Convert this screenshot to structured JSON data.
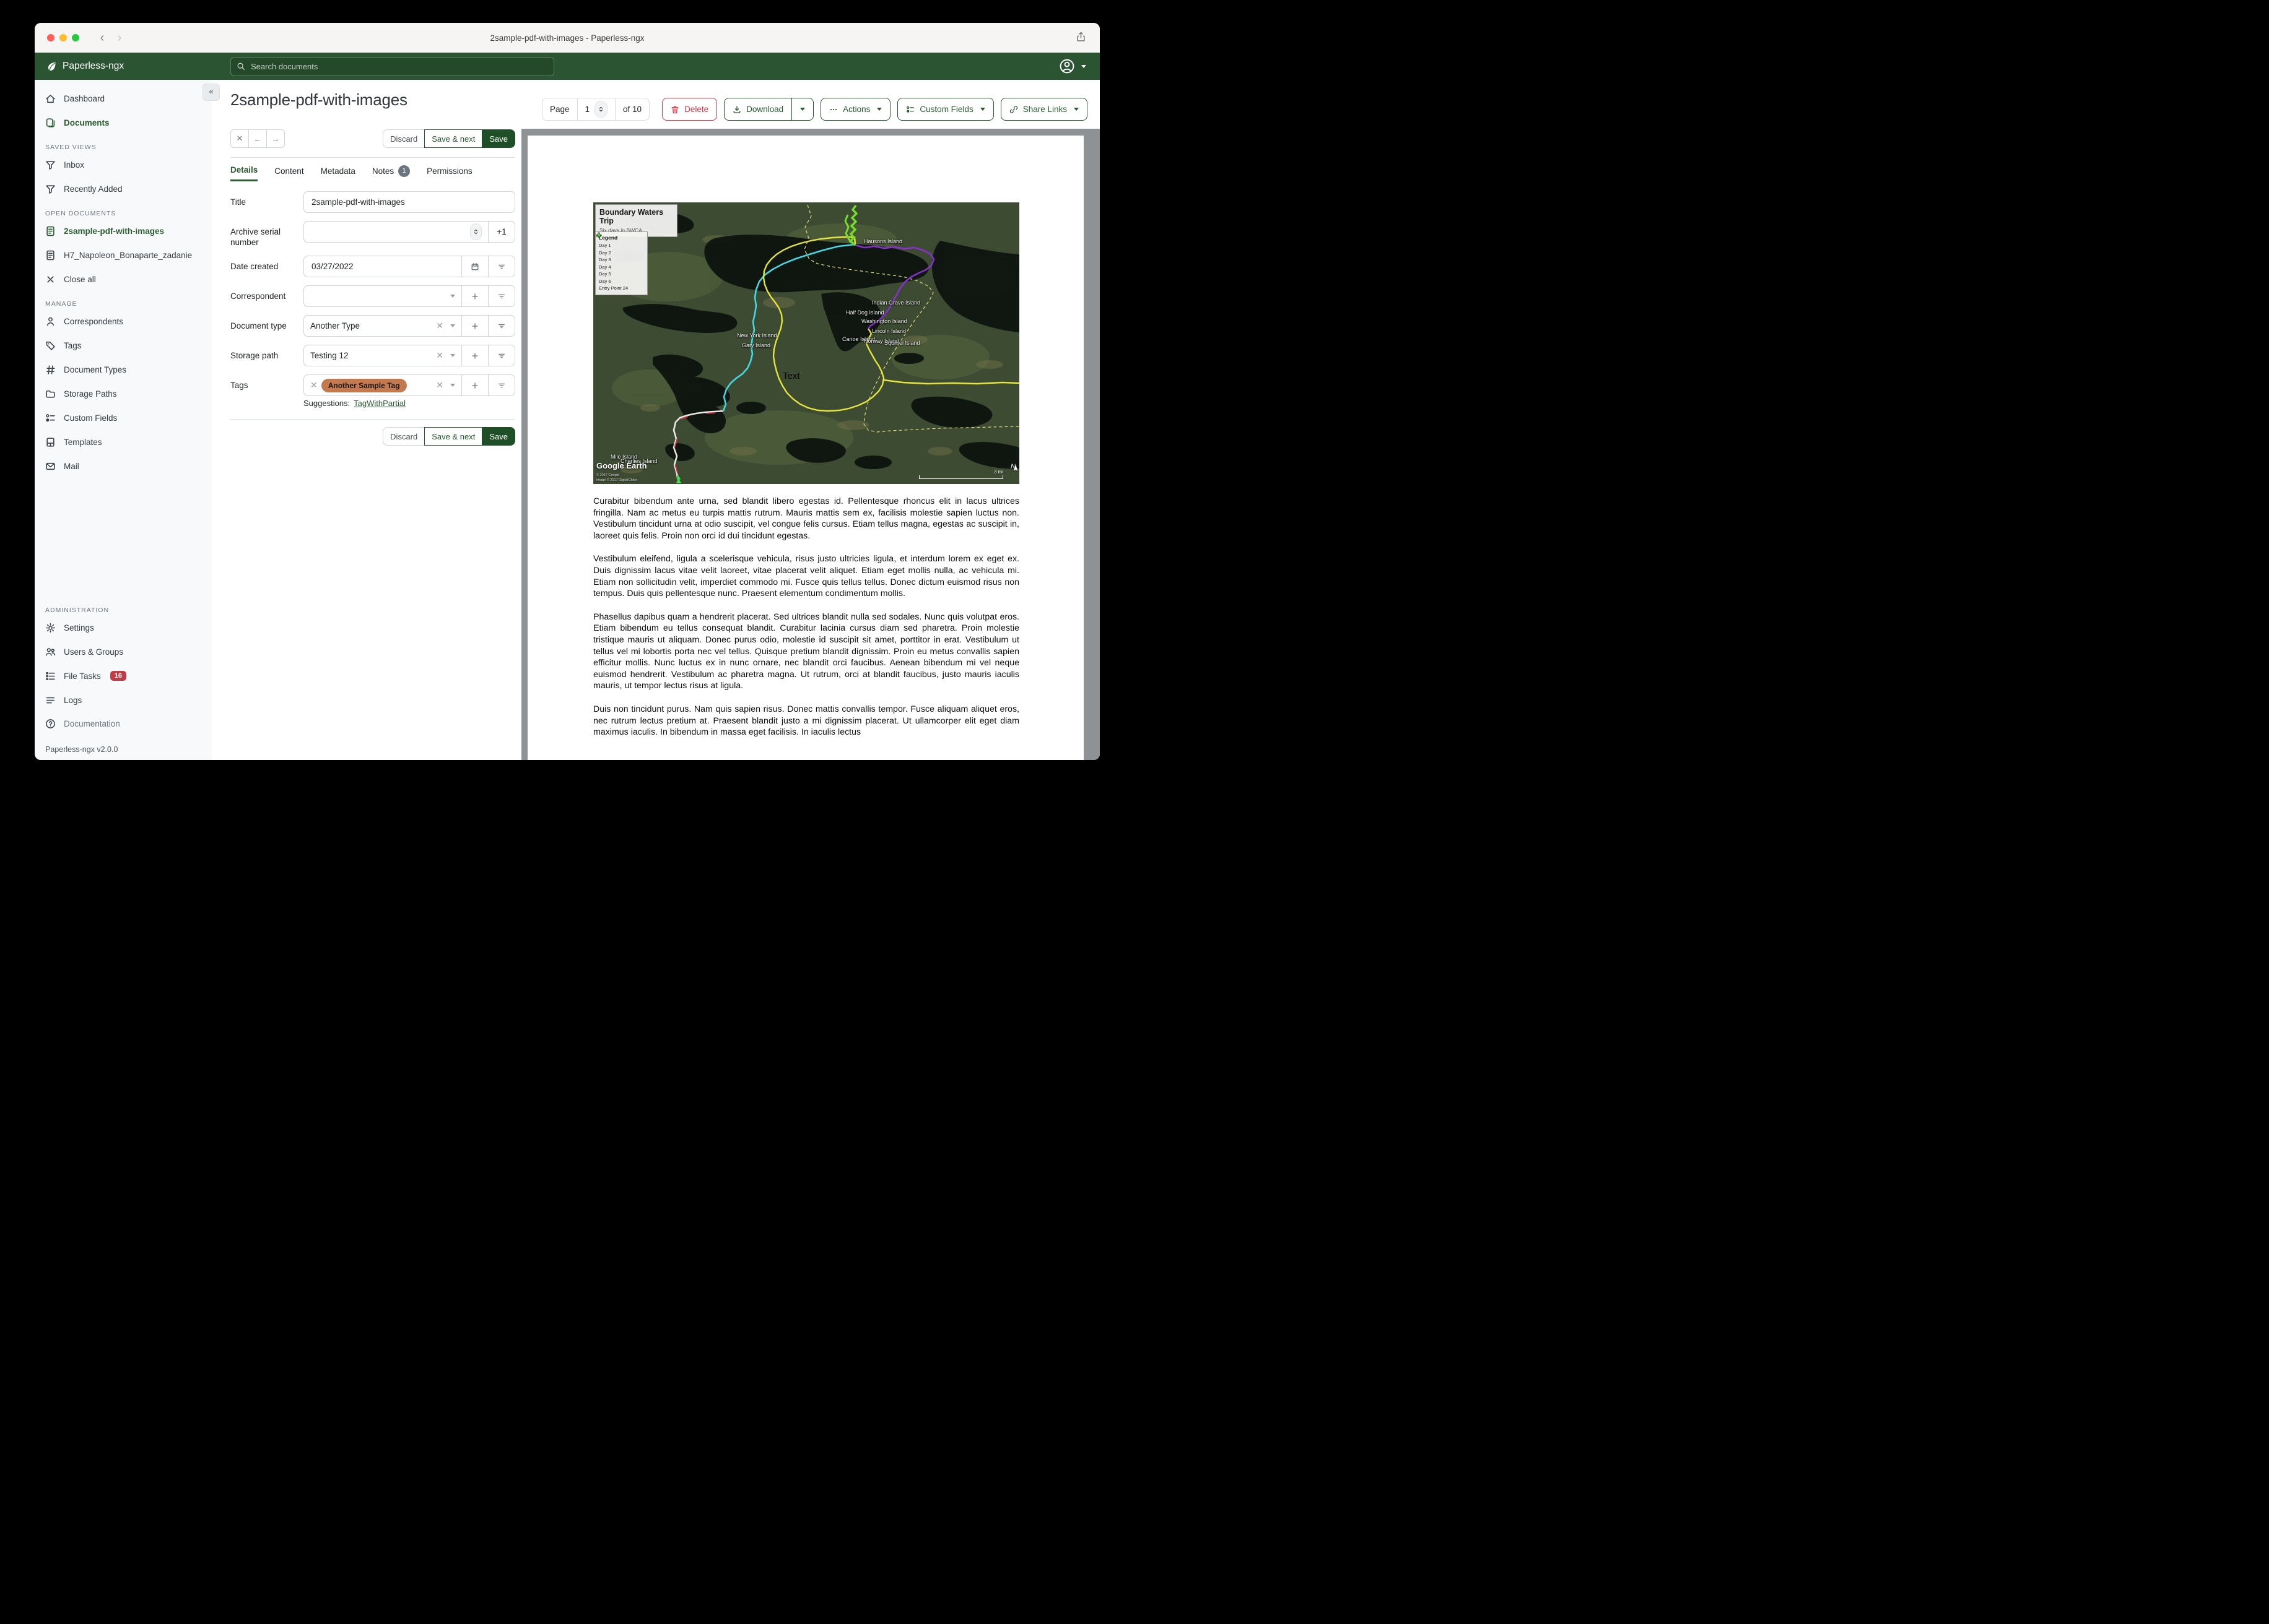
{
  "window": {
    "title": "2sample-pdf-with-images - Paperless-ngx"
  },
  "appbar": {
    "brand": "Paperless-ngx",
    "search_placeholder": "Search documents"
  },
  "colors": {
    "header_green": "#2b5532",
    "accent_green": "#265a2c",
    "save_fill": "#1e4f26",
    "delete_red": "#dc3545",
    "tag_chip": "#c4794e",
    "file_tasks_badge": "#c03c46"
  },
  "sidebar": {
    "primary": [
      {
        "label": "Dashboard"
      },
      {
        "label": "Documents"
      }
    ],
    "sections": [
      {
        "header": "SAVED VIEWS",
        "items": [
          "Inbox",
          "Recently Added"
        ]
      },
      {
        "header": "OPEN DOCUMENTS",
        "items": [
          "2sample-pdf-with-images",
          "H7_Napoleon_Bonaparte_zadanie",
          "Close all"
        ]
      },
      {
        "header": "MANAGE",
        "items": [
          "Correspondents",
          "Tags",
          "Document Types",
          "Storage Paths",
          "Custom Fields",
          "Templates",
          "Mail"
        ]
      },
      {
        "header": "ADMINISTRATION",
        "items": [
          "Settings",
          "Users & Groups",
          "File Tasks",
          "Logs"
        ]
      }
    ],
    "file_tasks_badge": "16",
    "documentation": "Documentation",
    "version": "Paperless-ngx v2.0.0"
  },
  "toolbar": {
    "page_label": "Page",
    "page_value": "1",
    "page_total": "of 10",
    "delete": "Delete",
    "download": "Download",
    "actions": "Actions",
    "custom_fields": "Custom Fields",
    "share_links": "Share Links"
  },
  "editor": {
    "title": "2sample-pdf-with-images",
    "discard": "Discard",
    "save_next": "Save & next",
    "save": "Save",
    "tabs": [
      "Details",
      "Content",
      "Metadata",
      "Notes",
      "Permissions"
    ],
    "notes_badge": "1",
    "fields": {
      "title_label": "Title",
      "title_value": "2sample-pdf-with-images",
      "asn_label": "Archive serial number",
      "asn_plus": "+1",
      "date_label": "Date created",
      "date_value": "03/27/2022",
      "correspondent_label": "Correspondent",
      "doctype_label": "Document type",
      "doctype_value": "Another Type",
      "storage_label": "Storage path",
      "storage_value": "Testing 12",
      "tags_label": "Tags",
      "tag_chip": "Another Sample Tag",
      "suggestions_label": "Suggestions:",
      "suggestion_link": "TagWithPartial"
    }
  },
  "preview": {
    "map": {
      "title": "Boundary Waters Trip",
      "subtitle": "Six days in BWCA",
      "legend_title": "Legend",
      "legend": [
        {
          "label": "Day 1",
          "color": "#e9e9e9"
        },
        {
          "label": "Day 2",
          "color": "#e4e43c"
        },
        {
          "label": "Day 3",
          "color": "#8a2fd0"
        },
        {
          "label": "Day 4",
          "color": "#74dd2c"
        },
        {
          "label": "Day 5",
          "color": "#46d7e4"
        },
        {
          "label": "Day 6",
          "color": "#bf3640"
        },
        {
          "label": "Entry Point 24",
          "color": "#4fe04f"
        }
      ],
      "islands": [
        "Hausons Island",
        "New York Island",
        "Gary Island",
        "Indian Grave Island",
        "Half Dog Island",
        "Washington Island",
        "Lincoln Island",
        "Canoe Island",
        "Norway Island",
        "Squirrel Island",
        "Mile Island",
        "Charlies Island"
      ],
      "text_label": "Text",
      "logo": "Google Earth",
      "copyright1": "© 2017 Google",
      "copyright2": "Image © 2017 DigitalGlobe",
      "scale": "3 mi",
      "compass": "N"
    },
    "paragraphs": [
      "Curabitur bibendum ante urna, sed blandit libero egestas id. Pellentesque rhoncus elit in lacus ultrices fringilla. Nam ac metus eu turpis mattis rutrum. Mauris mattis sem ex, facilisis molestie sapien luctus non. Vestibulum tincidunt urna at odio suscipit, vel congue felis cursus. Etiam tellus magna, egestas ac suscipit in, laoreet quis felis. Proin non orci id dui tincidunt egestas.",
      "Vestibulum eleifend, ligula a scelerisque vehicula, risus justo ultricies ligula, et interdum lorem ex eget ex. Duis dignissim lacus vitae velit laoreet, vitae placerat velit aliquet. Etiam eget mollis nulla, ac vehicula mi. Etiam non sollicitudin velit, imperdiet commodo mi. Fusce quis tellus tellus. Donec dictum euismod risus non tempus. Duis quis pellentesque nunc. Praesent elementum condimentum mollis.",
      "Phasellus dapibus quam a hendrerit placerat. Sed ultrices blandit nulla sed sodales. Nunc quis volutpat eros. Etiam bibendum eu tellus consequat blandit. Curabitur lacinia cursus diam sed pharetra. Proin molestie tristique mauris ut aliquam. Donec purus odio, molestie id suscipit sit amet, porttitor in erat. Vestibulum ut tellus vel mi lobortis porta nec vel tellus. Quisque pretium blandit dignissim. Proin eu metus convallis sapien efficitur mollis. Nunc luctus ex in nunc ornare, nec blandit orci faucibus. Aenean bibendum mi vel neque euismod hendrerit. Vestibulum ac pharetra magna. Ut rutrum, orci at blandit faucibus, justo mauris iaculis mauris, ut tempor lectus risus at ligula.",
      "Duis non tincidunt purus. Nam quis sapien risus. Donec mattis convallis tempor. Fusce aliquam aliquet eros, nec rutrum lectus pretium at. Praesent blandit justo a mi dignissim placerat. Ut ullamcorper elit eget diam maximus iaculis. In bibendum in massa eget facilisis. In iaculis lectus"
    ]
  }
}
